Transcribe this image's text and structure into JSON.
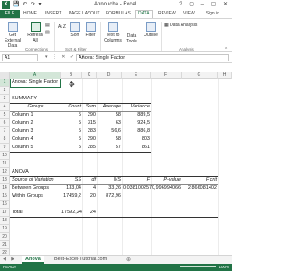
{
  "titlebar": {
    "title": "Annoucha - Excel",
    "logo": "X",
    "qat": "💾 ↶ ↷ ▾",
    "window_buttons": "? ▢ – ▢ ✕"
  },
  "ribbon_tabs": {
    "file": "FILE",
    "tabs": [
      "HOME",
      "INSERT",
      "PAGE LAYOUT",
      "FORMULAS",
      "DATA",
      "REVIEW",
      "VIEW"
    ],
    "active": "DATA",
    "signin": "Sign in"
  },
  "ribbon": {
    "get_external": "Get External Data",
    "refresh_all": "Refresh All",
    "connections_label": "Connections",
    "sort_az": "A↓Z",
    "sort": "Sort",
    "filter": "Filter",
    "sort_filter_label": "Sort & Filter",
    "text_to_columns": "Text to Columns",
    "data_tools": "Data Tools",
    "outline": "Outline",
    "data_analysis": "Data Analysis",
    "analysis_label": "Analysis"
  },
  "formula_bar": {
    "name_box": "A1",
    "icons": "▾ ⋮ ✕ ✓ fx",
    "value": "Anova: Single Factor"
  },
  "grid": {
    "columns": [
      "A",
      "B",
      "C",
      "D",
      "E",
      "F",
      "G",
      "H"
    ],
    "selected_column": "A",
    "rows": [
      "1",
      "2",
      "3",
      "4",
      "5",
      "6",
      "7",
      "8",
      "9",
      "10",
      "11",
      "12",
      "13",
      "14",
      "15",
      "16",
      "17",
      "18",
      "19",
      "20",
      "21",
      "22"
    ],
    "selected_row": "1"
  },
  "sheet": {
    "a1": "Anova: Single Factor",
    "summary_title": "SUMMARY",
    "summary_headers": [
      "Groups",
      "Count",
      "Sum",
      "Average",
      "Variance"
    ],
    "summary_rows": [
      [
        "Column 1",
        "5",
        "290",
        "58",
        "889,5"
      ],
      [
        "Column 2",
        "5",
        "315",
        "63",
        "924,5"
      ],
      [
        "Column 3",
        "5",
        "283",
        "56,6",
        "886,8"
      ],
      [
        "Column 4",
        "5",
        "290",
        "58",
        "803"
      ],
      [
        "Column 5",
        "5",
        "285",
        "57",
        "861"
      ]
    ],
    "anova_title": "ANOVA",
    "anova_headers": [
      "Source of Variation",
      "SS",
      "df",
      "MS",
      "F",
      "P-value",
      "F crit"
    ],
    "anova_rows": [
      [
        "Between Groups",
        "133,04",
        "4",
        "33,26",
        "0,038100257",
        "0,996994066",
        "2,866081402"
      ],
      [
        "Within Groups",
        "17459,2",
        "20",
        "872,96",
        "",
        "",
        ""
      ]
    ],
    "total_row": [
      "Total",
      "17592,24",
      "24"
    ]
  },
  "sheetbar": {
    "nav": "◀ ▶",
    "tabs": [
      "Anova",
      "Best-Excel-Tutorial.com"
    ],
    "active": "Anova",
    "add": "⊕"
  },
  "statusbar": {
    "left": "READY",
    "zoom": "100%"
  }
}
